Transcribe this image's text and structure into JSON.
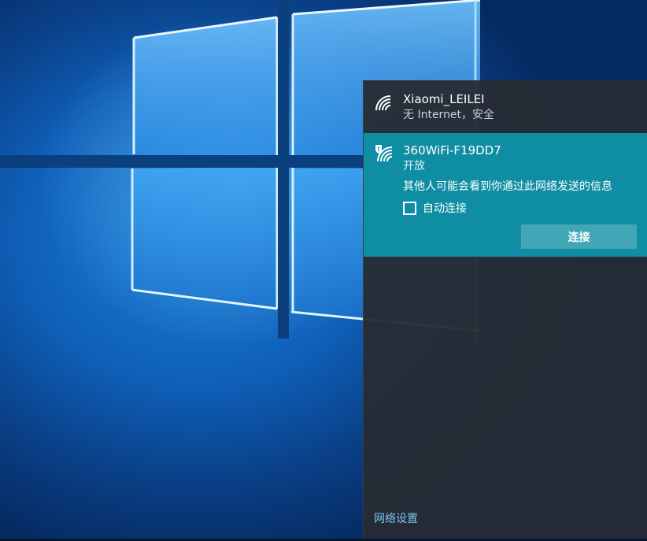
{
  "networks": [
    {
      "ssid": "Xiaomi_LEILEI",
      "status": "无 Internet，安全",
      "icon": "wifi-icon"
    },
    {
      "ssid": "360WiFi-F19DD7",
      "status": "开放",
      "icon": "wifi-shield-icon",
      "warning": "其他人可能会看到你通过此网络发送的信息",
      "auto_connect_label": "自动连接",
      "auto_connect_checked": false,
      "connect_label": "连接"
    }
  ],
  "footer": {
    "network_settings_label": "网络设置"
  },
  "colors": {
    "selected_bg": "#0f8da3",
    "panel_bg": "#262c34",
    "link": "#79c6ee",
    "desktop": "#0f5fb8"
  }
}
